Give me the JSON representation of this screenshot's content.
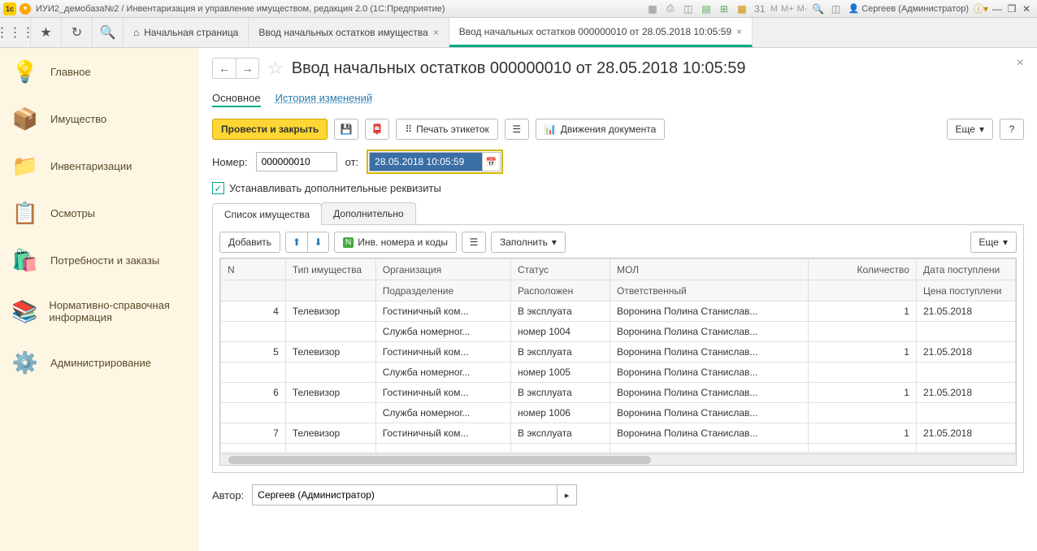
{
  "titlebar": {
    "title": "ИУИ2_демобаза№2 / Инвентаризация и управление имуществом, редакция 2.0  (1С:Предприятие)",
    "mtext": {
      "m": "M",
      "mplus": "M+",
      "mminus": "M-"
    },
    "user": "Сергеев (Администратор)"
  },
  "tabs": {
    "home": "Начальная страница",
    "t1": "Ввод начальных остатков имущества",
    "t2": "Ввод начальных остатков 000000010 от 28.05.2018 10:05:59"
  },
  "sidebar": {
    "main": "Главное",
    "property": "Имущество",
    "inventory": "Инвентаризации",
    "inspections": "Осмотры",
    "needs": "Потребности и заказы",
    "reference": "Нормативно-справочная информация",
    "admin": "Администрирование"
  },
  "doc": {
    "title": "Ввод начальных остатков 000000010 от 28.05.2018 10:05:59",
    "section_main": "Основное",
    "section_history": "История изменений",
    "post_close": "Провести и закрыть",
    "print_labels": "Печать этикеток",
    "movements": "Движения документа",
    "more": "Еще",
    "number_label": "Номер:",
    "number_value": "000000010",
    "date_label": "от:",
    "date_value": "28.05.2018 10:05:59",
    "set_extra": "Устанавливать дополнительные реквизиты",
    "tab_list": "Список имущества",
    "tab_extra": "Дополнительно",
    "add": "Добавить",
    "inv_numbers": "Инв. номера и коды",
    "fill": "Заполнить",
    "author_label": "Автор:",
    "author_value": "Сергеев (Администратор)"
  },
  "columns": {
    "n": "N",
    "type": "Тип имущества",
    "org": "Организация",
    "dept": "Подразделение",
    "status": "Статус",
    "location": "Расположен",
    "mol": "МОЛ",
    "responsible": "Ответственный",
    "qty": "Количество",
    "date_in": "Дата поступлени",
    "price_in": "Цена поступлени"
  },
  "rows": [
    {
      "n": "4",
      "type": "Телевизор",
      "org": "Гостиничный ком...",
      "dept": "Служба номерног...",
      "status": "В эксплуата",
      "location": "номер 1004",
      "mol": "Воронина Полина Станислав...",
      "resp": "Воронина Полина Станислав...",
      "qty": "1",
      "date": "21.05.2018"
    },
    {
      "n": "5",
      "type": "Телевизор",
      "org": "Гостиничный ком...",
      "dept": "Служба номерног...",
      "status": "В эксплуата",
      "location": "номер 1005",
      "mol": "Воронина Полина Станислав...",
      "resp": "Воронина Полина Станислав...",
      "qty": "1",
      "date": "21.05.2018"
    },
    {
      "n": "6",
      "type": "Телевизор",
      "org": "Гостиничный ком...",
      "dept": "Служба номерног...",
      "status": "В эксплуата",
      "location": "номер 1006",
      "mol": "Воронина Полина Станислав...",
      "resp": "Воронина Полина Станислав...",
      "qty": "1",
      "date": "21.05.2018"
    },
    {
      "n": "7",
      "type": "Телевизор",
      "org": "Гостиничный ком...",
      "dept": "",
      "status": "В эксплуата",
      "location": "",
      "mol": "Воронина Полина Станислав...",
      "resp": "",
      "qty": "1",
      "date": "21.05.2018"
    }
  ]
}
